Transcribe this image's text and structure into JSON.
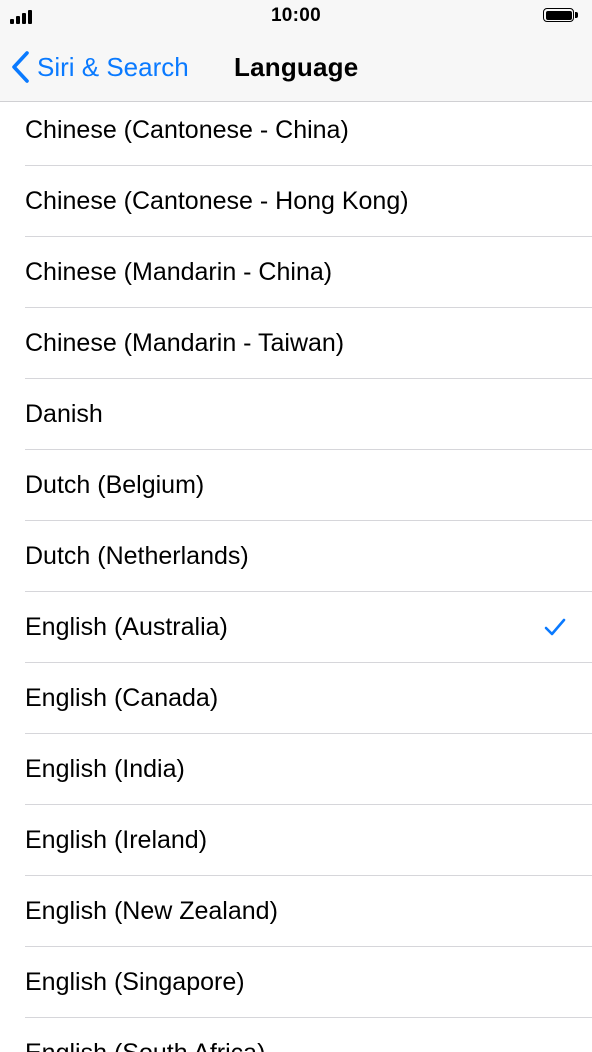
{
  "status_bar": {
    "time": "10:00"
  },
  "nav": {
    "back_label": "Siri & Search",
    "title": "Language"
  },
  "accent_color": "#0a7aff",
  "icons": {
    "back": "chevron-left-icon",
    "selected": "checkmark-icon",
    "signal": "cellular-signal-icon",
    "battery": "battery-icon"
  },
  "languages": {
    "items": [
      {
        "label": "Chinese (Cantonese - China)",
        "selected": false
      },
      {
        "label": "Chinese (Cantonese - Hong Kong)",
        "selected": false
      },
      {
        "label": "Chinese (Mandarin - China)",
        "selected": false
      },
      {
        "label": "Chinese (Mandarin - Taiwan)",
        "selected": false
      },
      {
        "label": "Danish",
        "selected": false
      },
      {
        "label": "Dutch (Belgium)",
        "selected": false
      },
      {
        "label": "Dutch (Netherlands)",
        "selected": false
      },
      {
        "label": "English (Australia)",
        "selected": true
      },
      {
        "label": "English (Canada)",
        "selected": false
      },
      {
        "label": "English (India)",
        "selected": false
      },
      {
        "label": "English (Ireland)",
        "selected": false
      },
      {
        "label": "English (New Zealand)",
        "selected": false
      },
      {
        "label": "English (Singapore)",
        "selected": false
      },
      {
        "label": "English (South Africa)",
        "selected": false
      }
    ]
  }
}
